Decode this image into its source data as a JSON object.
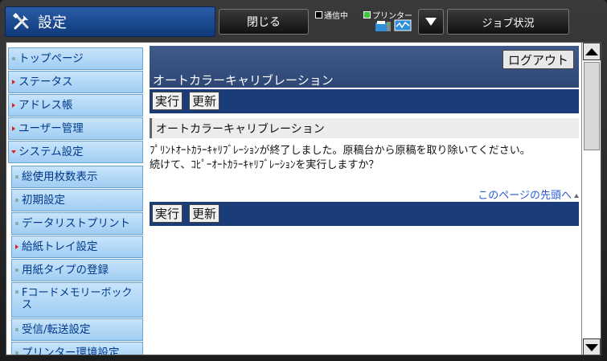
{
  "header": {
    "title": "設定",
    "title_icon": "wrench-screwdriver-icon",
    "close_label": "閉じる",
    "comm_label": "通信中",
    "printer_label": "プリンター",
    "job_status_label": "ジョブ状況"
  },
  "sidebar": {
    "items": [
      {
        "label": "トップページ",
        "marker": "dot"
      },
      {
        "label": "ステータス",
        "marker": "triangle"
      },
      {
        "label": "アドレス帳",
        "marker": "triangle"
      },
      {
        "label": "ユーザー管理",
        "marker": "triangle"
      },
      {
        "label": "システム設定",
        "marker": "triangle-down"
      },
      {
        "label": "総使用枚数表示",
        "marker": "dot"
      },
      {
        "label": "初期設定",
        "marker": "dot"
      },
      {
        "label": "データリストプリント",
        "marker": "dot"
      },
      {
        "label": "給紙トレイ設定",
        "marker": "triangle"
      },
      {
        "label": "用紙タイプの登録",
        "marker": "dot"
      },
      {
        "label": "Fコードメモリーボックス",
        "marker": "dot"
      },
      {
        "label": "受信/転送設定",
        "marker": "dot"
      },
      {
        "label": "プリンター環境設定",
        "marker": "dot"
      }
    ]
  },
  "main": {
    "logout_label": "ログアウト",
    "page_heading": "オートカラーキャリブレーション",
    "execute_label": "実行",
    "update_label": "更新",
    "section_title": "オートカラーキャリブレーション",
    "message_line1": "ﾌﾟﾘﾝﾄｵｰﾄｶﾗｰｷｬﾘﾌﾞﾚｰｼｮﾝが終了しました。原稿台から原稿を取り除いてください。",
    "message_line2": "続けて、ｺﾋﾟｰｵｰﾄｶﾗｰｷｬﾘﾌﾞﾚｰｼｮﾝを実行しますか？",
    "page_top_link": "このページの先頭へ"
  },
  "colors": {
    "title_bar": "#1f4f96",
    "sidebar_item": "#b6dbf7",
    "content_band": "#1a3d7a",
    "link": "#2a5bd7"
  }
}
